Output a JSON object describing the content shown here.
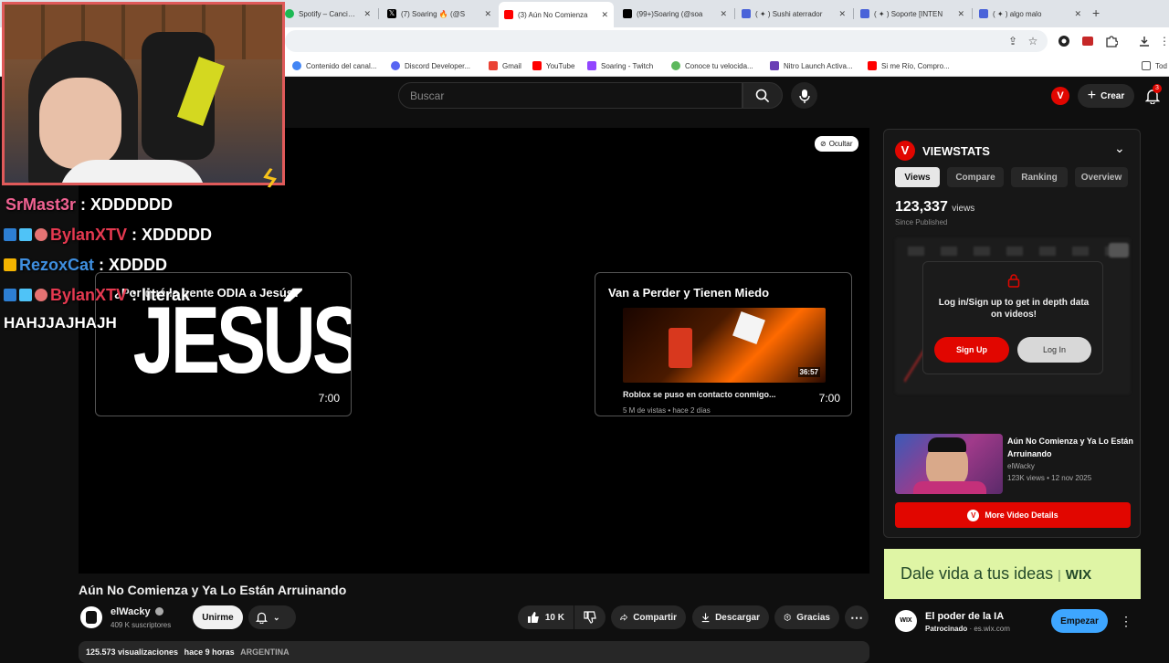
{
  "browser": {
    "tabs": [
      {
        "label": "Spotify – Canciones q",
        "color": "#1db954"
      },
      {
        "label": "(7) Soaring 🔥 (@S",
        "color": "#000000"
      },
      {
        "label": "(3) Aún No Comienza",
        "color": "#ff0000",
        "active": true
      },
      {
        "label": "(99+)Soaring (@soa",
        "color": "#000000"
      },
      {
        "label": "( ✦ ) Sushi aterrador",
        "color": "#4a63d9"
      },
      {
        "label": "( ✦ ) Soporte [INTEN",
        "color": "#4a63d9"
      },
      {
        "label": "( ✦ ) algo malo",
        "color": "#4a63d9"
      }
    ],
    "new_tab_label": "+",
    "bookmarks": [
      {
        "label": "Contenido del canal...",
        "color": "#4285f4"
      },
      {
        "label": "Discord Developer...",
        "color": "#5865f2"
      },
      {
        "label": "Gmail",
        "color": "#ea4335"
      },
      {
        "label": "YouTube",
        "color": "#ff0000"
      },
      {
        "label": "Soaring - Twitch",
        "color": "#9146ff"
      },
      {
        "label": "Conoce tu velocida...",
        "color": "#5cb85c"
      },
      {
        "label": "Nitro Launch Activa...",
        "color": "#6a3fb5"
      },
      {
        "label": "Si me Río, Compro...",
        "color": "#ff0000"
      },
      {
        "label": "Tod",
        "color": "#777777"
      }
    ]
  },
  "youtube": {
    "search_placeholder": "Buscar",
    "create_label": "Crear",
    "notifications_count": "3",
    "video": {
      "hide_label": "Ocultar",
      "endcards": [
        {
          "title": "¿Por qué la gente ODIA a Jesús?",
          "big_text": "JESÚS",
          "duration": "7:00"
        },
        {
          "title": "Van a Perder y Tienen Miedo",
          "inner_title": "Roblox se puso en contacto conmigo...",
          "inner_duration": "36:57",
          "inner_meta": "5 M de vistas • hace 2 días",
          "duration": "7:00"
        }
      ],
      "title": "Aún No Comienza y Ya Lo Están Arruinando",
      "channel": "elWacky",
      "subscribers": "409 K suscriptores",
      "join_label": "Unirme",
      "likes": "10 K",
      "share_label": "Compartir",
      "download_label": "Descargar",
      "thanks_label": "Gracias",
      "views_line": "125.573 visualizaciones",
      "time_ago": "hace 9 horas",
      "country": "ARGENTINA"
    }
  },
  "chat": [
    {
      "user": "SrMast3r",
      "message": " : XDDDDDD",
      "color": "#f06292",
      "badges": []
    },
    {
      "user": "BylanXTV",
      "message": " : XDDDDD",
      "color": "#e53950",
      "badges": [
        "#2d7fd3",
        "#4fc3f7",
        "#e57373"
      ]
    },
    {
      "user": "RezoxCat",
      "message": " : XDDDD",
      "color": "#3f8fe0",
      "badges": [
        "#f5b400"
      ]
    },
    {
      "user": "BylanXTV",
      "message": " : literak",
      "color": "#e53950",
      "badges": [
        "#2d7fd3",
        "#4fc3f7",
        "#e57373"
      ]
    },
    {
      "user": "",
      "message": "HAHJJAJHAJH",
      "color": "#ffffff",
      "badges": []
    }
  ],
  "viewstats": {
    "brand": "VIEWSTATS",
    "tabs": [
      "Views",
      "Compare",
      "Ranking",
      "Overview"
    ],
    "views_count": "123,337",
    "views_unit": "views",
    "since": "Since Published",
    "login_prompt": "Log in/Sign up to get in depth data on videos!",
    "signup_label": "Sign Up",
    "login_label": "Log In",
    "video_title": "Aún No Comienza y Ya Lo Están Arruinando",
    "video_channel": "elWacky",
    "video_meta": "123K views • 12 nov 2025",
    "more_details_label": "More Video Details"
  },
  "ad": {
    "banner_text": "Dale vida a tus ideas",
    "banner_brand": "WIX",
    "title": "El poder de la IA",
    "sponsored": "Patrocinado",
    "domain": "· es.wix.com",
    "cta_label": "Empezar",
    "logo_text": "WIX"
  }
}
